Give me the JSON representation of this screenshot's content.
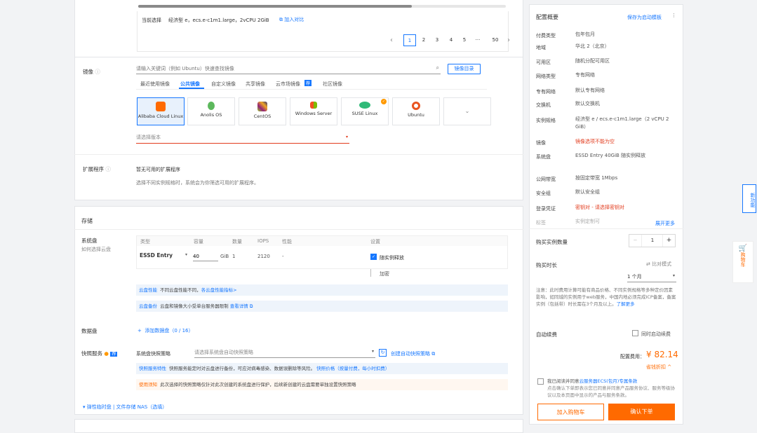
{
  "instance": {
    "current_label": "当前选择",
    "current_value": "经济型 e，ecs.e-c1m1.large，2vCPU 2GiB",
    "compare": "加入对比"
  },
  "pagination": {
    "pages": [
      "1",
      "2",
      "3",
      "4",
      "5",
      "···",
      "50"
    ],
    "prev": "‹",
    "next": "›"
  },
  "image": {
    "label": "镜像",
    "search_placeholder": "请输入关键词（例如 Ubuntu）快速查找镜像",
    "market_button": "镜像目录",
    "tabs": [
      "最近使用镜像",
      "公共镜像",
      "自定义镜像",
      "共享镜像",
      "云市场镜像",
      "社区镜像"
    ],
    "tab_badge": "荐",
    "tiles": [
      "Alibaba Cloud Linux",
      "Anolis OS",
      "CentOS",
      "Windows Server",
      "SUSE Linux",
      "Ubuntu"
    ],
    "version_placeholder": "请选择版本"
  },
  "ext": {
    "label": "扩展程序",
    "title": "暂无可用的扩展程序",
    "desc": "选择不同实例规格时，系统会为你筛选可用的扩展程序。"
  },
  "storage": {
    "title": "存储",
    "system_disk_label": "系统盘",
    "system_disk_link": "如何选择云盘",
    "headers": [
      "类型",
      "容量",
      "数量",
      "IOPS",
      "性能",
      "设置"
    ],
    "type_value": "ESSD Entry",
    "size_value": "40",
    "size_unit": "GiB",
    "count_value": "1",
    "iops_value": "2120",
    "perf_value": "-",
    "release_label": "随实例释放",
    "encrypt_label": "加密",
    "perf_note_tag": "云盘性能",
    "perf_note": "不同云盘性能不同，",
    "perf_note_link": "各云盘性能指标>",
    "backup_note_tag": "云盘备份",
    "backup_note": "云盘和镜像大小受单台服务器限制",
    "backup_note_link": "查看详情",
    "data_disk_label": "数据盘",
    "data_disk_add": "添加数据盘（0 / 16）",
    "snapshot_label": "快照服务",
    "snapshot_badge": "荐",
    "snapshot_policy_label": "系统盘快照策略",
    "snapshot_placeholder": "请选择系统盘自动快照策略",
    "snapshot_create": "创建自动快照策略",
    "snap_note_tag": "快照服务特性",
    "snap_note": "快照服务能定时对云盘进行备份，可应对病毒感染、数据误删除等风险。",
    "snap_note_link": "快照价格（按量付费，每小时扣费）",
    "snap_warn_tag": "使用须知",
    "snap_warn": "此次选择的快照策略仅针对此次创建的系统盘进行保护，后续新创建的云盘需要单独设置快照策略",
    "more": "弹性临时盘 | 文件存储 NAS（选填）"
  },
  "summary": {
    "title": "配置概要",
    "save_template": "保存为启动模板",
    "rows": [
      {
        "k": "付费类型",
        "v": "包年包月"
      },
      {
        "k": "地域",
        "v": "华北 2（北京）"
      },
      {
        "k": "可用区",
        "v": "随机分配可用区"
      },
      {
        "k": "网络类型",
        "v": "专有网络"
      },
      {
        "k": "专有网络",
        "v": "默认专有网络"
      },
      {
        "k": "交换机",
        "v": "默认交换机"
      },
      {
        "k": "实例规格",
        "v": "经济型 e / ecs.e-c1m1.large（2 vCPU 2 GiB）"
      },
      {
        "k": "镜像",
        "v": "镜像选项不能为空"
      },
      {
        "k": "系统盘",
        "v": "ESSD Entry 40GiB 随实例释放"
      },
      {
        "k": "公网带宽",
        "v": "按固定带宽 1Mbps"
      },
      {
        "k": "安全组",
        "v": "默认安全组"
      },
      {
        "k": "登录凭证",
        "v": "密钥对 - 请选择密钥对"
      },
      {
        "k": "标签",
        "v": "实例定制可"
      }
    ],
    "expand": "展开更多",
    "quantity_label": "购买实例数量",
    "quantity": "1",
    "duration_label": "购买时长",
    "compare_mode": "比对模式",
    "duration_value": "1 个月",
    "notice": "注意：此时费用计算可能有商品价格、不同实例规格等多种定价因素影响，如同城的实例用于web服务，中国内地必须完成ICP备案，备案实例（包括带）时长需在3个月及以上。",
    "notice_link": "了解更多",
    "auto_renew_label": "自动续费",
    "auto_renew_option": "同时启动续费",
    "price_label": "配置费用：",
    "price": "¥ 82.14",
    "price_detail": "省钱折扣 ^",
    "agree_prefix": "我已阅读并同意",
    "agree_link": "云服务器ECS(包月)专属条款",
    "agree_more": "点击确认下单即表示您已同意并同意产品服务协议、服务等级协议以及本页面中显示的产品与服务条款。",
    "cart_button": "加入购物车",
    "order_button": "确认下单"
  },
  "side": {
    "new_feature": "新功能",
    "cart": "购物车"
  }
}
